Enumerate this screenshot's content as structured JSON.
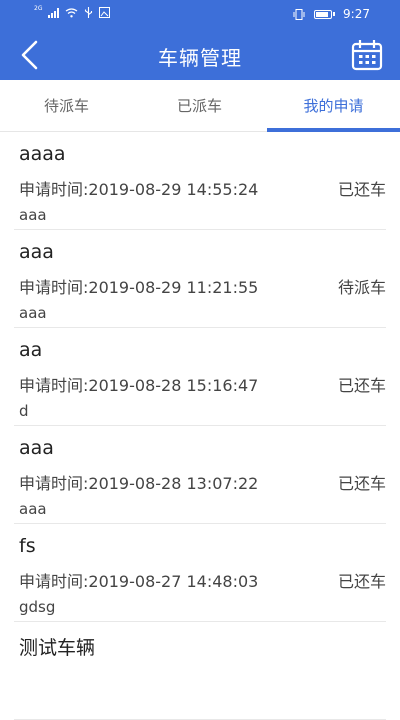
{
  "status_bar": {
    "network": "2G",
    "time": "9:27"
  },
  "header": {
    "title": "车辆管理"
  },
  "tabs": [
    {
      "label": "待派车"
    },
    {
      "label": "已派车"
    },
    {
      "label": "我的申请",
      "active": true
    }
  ],
  "applications": [
    {
      "name": "aaaa",
      "time": "申请时间:2019-08-29 14:55:24",
      "status": "已还车",
      "note": "aaa"
    },
    {
      "name": "aaa",
      "time": "申请时间:2019-08-29 11:21:55",
      "status": "待派车",
      "note": "aaa"
    },
    {
      "name": "aa",
      "time": "申请时间:2019-08-28 15:16:47",
      "status": "已还车",
      "note": "d"
    },
    {
      "name": "aaa",
      "time": "申请时间:2019-08-28 13:07:22",
      "status": "已还车",
      "note": "aaa"
    },
    {
      "name": "fs",
      "time": "申请时间:2019-08-27 14:48:03",
      "status": "已还车",
      "note": "gdsg"
    },
    {
      "name": "测试车辆",
      "time": "",
      "status": "",
      "note": ""
    }
  ],
  "colors": {
    "primary": "#3d6fd9",
    "text": "#444444",
    "divider": "#e8e8e8"
  }
}
